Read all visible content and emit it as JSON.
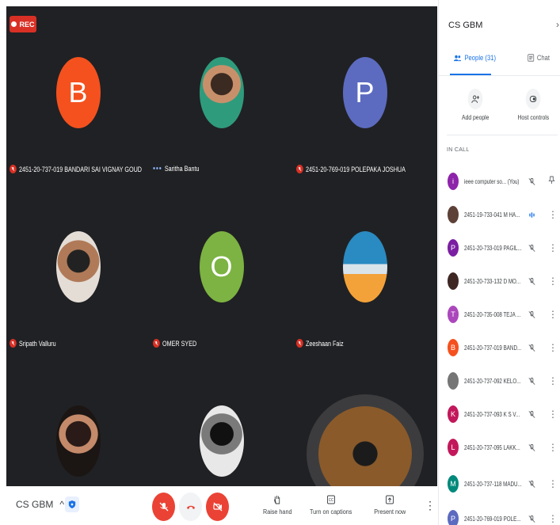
{
  "recording": {
    "label": "REC"
  },
  "tiles": [
    {
      "name": "2451-20-737-019 BANDARI SAI VIGNAY GOUD",
      "initial": "B",
      "color": "#f4511e",
      "status": "muted",
      "kind": "letter"
    },
    {
      "name": "Saritha Bantu",
      "initial": "",
      "color": "",
      "status": "talking",
      "kind": "photo"
    },
    {
      "name": "2451-20-769-019 POLEPAKA JOSHUA",
      "initial": "P",
      "color": "#5c6bc0",
      "status": "muted",
      "kind": "letter"
    },
    {
      "name": "Sripath Valluru",
      "initial": "",
      "color": "",
      "status": "muted",
      "kind": "photo"
    },
    {
      "name": "OMER SYED",
      "initial": "O",
      "color": "#7cb342",
      "status": "muted",
      "kind": "letter"
    },
    {
      "name": "Zeeshaan Faiz",
      "initial": "",
      "color": "",
      "status": "muted",
      "kind": "photo"
    }
  ],
  "bottombar": {
    "meeting_name": "CS GBM",
    "chevron": "^",
    "raise_hand": "Raise hand",
    "captions": "Turn on captions",
    "present": "Present now",
    "more": "⋮"
  },
  "panel": {
    "title": "CS GBM",
    "close": "›",
    "tab_people": "People (31)",
    "tab_chat": "Chat",
    "add_people": "Add people",
    "host_controls": "Host controls",
    "in_call": "IN CALL",
    "participants": [
      {
        "name": "ieee computer so... (You)",
        "initial": "i",
        "color": "#8e24aa",
        "icon": "mic-off",
        "extra": "pin"
      },
      {
        "name": "2451-19-733-041 M HA...",
        "initial": "",
        "color": "#5d4037",
        "icon": "talking",
        "extra": "more"
      },
      {
        "name": "2451-20-733-019 PAGIL...",
        "initial": "P",
        "color": "#7b1fa2",
        "icon": "mic-off",
        "extra": "more"
      },
      {
        "name": "2451-20-733-132 D MO...",
        "initial": "",
        "color": "#3e2723",
        "icon": "mic-off",
        "extra": "more"
      },
      {
        "name": "2451-20-735-008 TEJA ...",
        "initial": "T",
        "color": "#ab47bc",
        "icon": "mic-off",
        "extra": "more"
      },
      {
        "name": "2451-20-737-019 BAND...",
        "initial": "B",
        "color": "#f4511e",
        "icon": "mic-off",
        "extra": "more"
      },
      {
        "name": "2451-20-737-092 KELO...",
        "initial": "",
        "color": "#757575",
        "icon": "mic-off",
        "extra": "more"
      },
      {
        "name": "2451-20-737-093 K S V...",
        "initial": "K",
        "color": "#c2185b",
        "icon": "mic-off",
        "extra": "more"
      },
      {
        "name": "2451-20-737-095 LAKK...",
        "initial": "L",
        "color": "#c2185b",
        "icon": "mic-off",
        "extra": "more"
      },
      {
        "name": "2451-20-737-118 MADU...",
        "initial": "M",
        "color": "#00897b",
        "icon": "mic-off",
        "extra": "more"
      },
      {
        "name": "2451-20-769-019 POLE...",
        "initial": "P",
        "color": "#5c6bc0",
        "icon": "mic-off",
        "extra": "more"
      }
    ]
  },
  "colors": {
    "accent": "#1a73e8",
    "danger": "#ea4335",
    "stage": "#202124"
  }
}
